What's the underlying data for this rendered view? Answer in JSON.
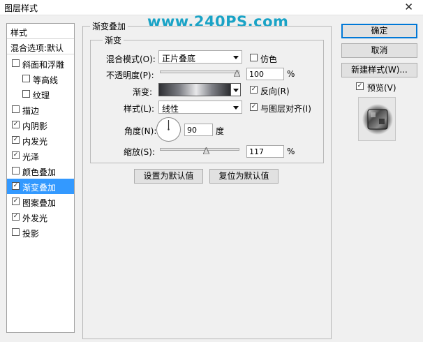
{
  "window": {
    "title": "图层样式",
    "close_glyph": "✕"
  },
  "watermark": "www.240PS.com",
  "sidebar": {
    "header": "样式",
    "blend_options": "混合选项:默认",
    "items": [
      {
        "label": "斜面和浮雕",
        "checked": false
      },
      {
        "label": "等高线",
        "checked": false,
        "sub": true
      },
      {
        "label": "纹理",
        "checked": false,
        "sub": true
      },
      {
        "label": "描边",
        "checked": false
      },
      {
        "label": "内阴影",
        "checked": true
      },
      {
        "label": "内发光",
        "checked": true
      },
      {
        "label": "光泽",
        "checked": true
      },
      {
        "label": "颜色叠加",
        "checked": false
      },
      {
        "label": "渐变叠加",
        "checked": true,
        "selected": true
      },
      {
        "label": "图案叠加",
        "checked": true
      },
      {
        "label": "外发光",
        "checked": true
      },
      {
        "label": "投影",
        "checked": false
      }
    ]
  },
  "panel": {
    "title": "渐变叠加",
    "subtitle": "渐变",
    "blend_mode_label": "混合模式(O):",
    "blend_mode_value": "正片叠底",
    "dither_label": "仿色",
    "opacity_label": "不透明度(P):",
    "opacity_value": "100",
    "opacity_unit": "%",
    "opacity_level": 1.0,
    "gradient_label": "渐变:",
    "reverse_label": "反向(R)",
    "style_label": "样式(L):",
    "style_value": "线性",
    "align_label": "与图层对齐(I)",
    "angle_label": "角度(N):",
    "angle_value": "90",
    "angle_unit": "度",
    "scale_label": "缩放(S):",
    "scale_value": "117",
    "scale_unit": "%",
    "scale_level": 0.585,
    "set_default_label": "设置为默认值",
    "reset_default_label": "复位为默认值"
  },
  "buttons": {
    "ok": "确定",
    "cancel": "取消",
    "new_style": "新建样式(W)...",
    "preview_label": "预览(V)"
  }
}
